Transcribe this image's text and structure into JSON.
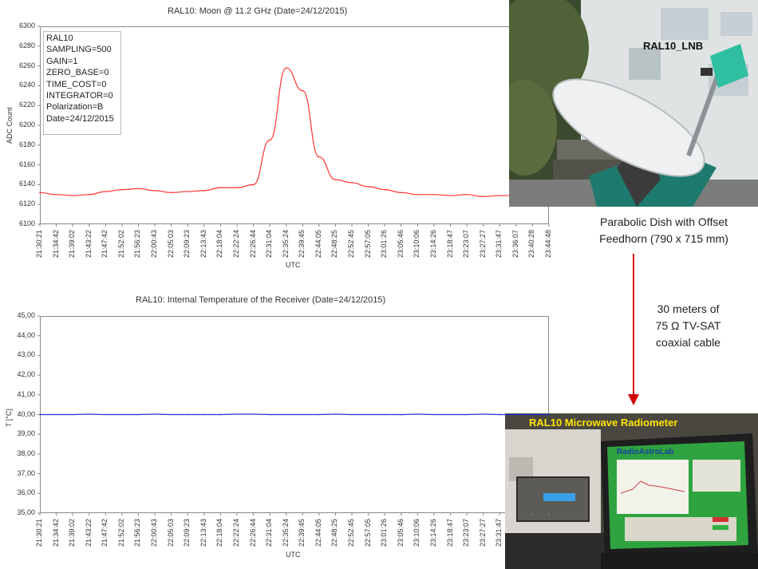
{
  "charts": {
    "moon": {
      "title": "RAL10: Moon @ 11.2 GHz (Date=24/12/2015)",
      "ylabel": "ADC Count",
      "xlabel": "UTC",
      "yticks": [
        "6300",
        "6280",
        "6260",
        "6240",
        "6220",
        "6200",
        "6180",
        "6160",
        "6140",
        "6120",
        "6100"
      ],
      "params": [
        "RAL10",
        "SAMPLING=500",
        "GAIN=1",
        "ZERO_BASE=0",
        "TIME_COST=0",
        "INTEGRATOR=0",
        "Polarization=B",
        "Date=24/12/2015"
      ]
    },
    "temp": {
      "title": "RAL10: Internal Temperature of the Receiver (Date=24/12/2015)",
      "ylabel": "T [°C]",
      "xlabel": "UTC",
      "yticks": [
        "45,00",
        "44,00",
        "43,00",
        "42,00",
        "41,00",
        "40,00",
        "39,00",
        "38,00",
        "37,00",
        "36,00",
        "35,00"
      ]
    },
    "xticks": [
      "21:30:21",
      "21:34:42",
      "21:39:02",
      "21:43:22",
      "21:47:42",
      "21:52:02",
      "21:56:23",
      "22:00:43",
      "22:05:03",
      "22:09:23",
      "22:13:43",
      "22:18:04",
      "22:22:24",
      "22:26:44",
      "22:31:04",
      "22:35:24",
      "22:39:45",
      "22:44:05",
      "22:48:25",
      "22:52:45",
      "22:57:05",
      "23:01:26",
      "23:05:46",
      "23:10:06",
      "23:14:26",
      "23:18:47",
      "23:23:07",
      "23:27:27",
      "23:31:47",
      "23:36:07",
      "23:40:28",
      "23:44:48"
    ]
  },
  "chart_data": [
    {
      "type": "line",
      "title": "RAL10: Moon @ 11.2 GHz (Date=24/12/2015)",
      "xlabel": "UTC",
      "ylabel": "ADC Count",
      "ylim": [
        6100,
        6300
      ],
      "grid": false,
      "color": "#ff3333",
      "x": [
        "21:30:21",
        "21:34:42",
        "21:39:02",
        "21:43:22",
        "21:47:42",
        "21:52:02",
        "21:56:23",
        "22:00:43",
        "22:05:03",
        "22:09:23",
        "22:13:43",
        "22:18:04",
        "22:22:24",
        "22:26:44",
        "22:31:04",
        "22:35:24",
        "22:39:45",
        "22:44:05",
        "22:48:25",
        "22:52:45",
        "22:57:05",
        "23:01:26",
        "23:05:46",
        "23:10:06",
        "23:14:26",
        "23:18:47",
        "23:23:07",
        "23:27:27",
        "23:31:47",
        "23:36:07",
        "23:40:28",
        "23:44:48"
      ],
      "series": [
        {
          "values": [
            6132,
            6130,
            6129,
            6130,
            6133,
            6135,
            6136,
            6134,
            6132,
            6133,
            6134,
            6137,
            6137,
            6140,
            6185,
            6258,
            6235,
            6168,
            6145,
            6142,
            6138,
            6135,
            6132,
            6130,
            6130,
            6129,
            6130,
            6128,
            6129,
            6129,
            6128,
            6128
          ]
        }
      ]
    },
    {
      "type": "line",
      "title": "RAL10: Internal Temperature of the Receiver (Date=24/12/2015)",
      "xlabel": "UTC",
      "ylabel": "T [°C]",
      "ylim": [
        35,
        45
      ],
      "grid": false,
      "color": "#2233cc",
      "x": [
        "21:30:21",
        "21:34:42",
        "21:39:02",
        "21:43:22",
        "21:47:42",
        "21:52:02",
        "21:56:23",
        "22:00:43",
        "22:05:03",
        "22:09:23",
        "22:13:43",
        "22:18:04",
        "22:22:24",
        "22:26:44",
        "22:31:04",
        "22:35:24",
        "22:39:45",
        "22:44:05",
        "22:48:25",
        "22:52:45",
        "22:57:05",
        "23:01:26",
        "23:05:46",
        "23:10:06",
        "23:14:26",
        "23:18:47",
        "23:23:07",
        "23:27:27",
        "23:31:47",
        "23:36:07",
        "23:40:28",
        "23:44:48"
      ],
      "series": [
        {
          "values": [
            40,
            40,
            40,
            40.02,
            40,
            40,
            40,
            40.02,
            40,
            40,
            40,
            40,
            40.02,
            40.02,
            40,
            40,
            40,
            40,
            40.02,
            40,
            40,
            40,
            40,
            40.02,
            40,
            40,
            40,
            40.02,
            40,
            40,
            40,
            40
          ]
        }
      ]
    }
  ],
  "photos": {
    "lnb_label": "RAL10_LNB",
    "dish_caption_line1": "Parabolic Dish with Offset",
    "dish_caption_line2": "Feedhorn (790 x 715 mm)",
    "cable_line1": "30 meters of",
    "cable_line2": "75 Ω TV-SAT",
    "cable_line3": "coaxial cable",
    "radiometer_label": "RAL10 Microwave Radiometer",
    "screen_brand": "RadioAstroLab"
  }
}
